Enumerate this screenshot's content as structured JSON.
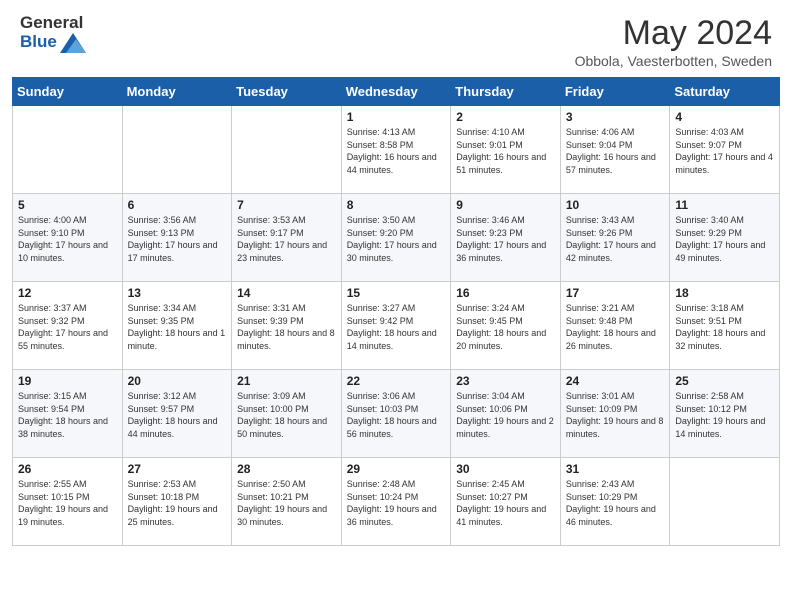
{
  "header": {
    "logo_general": "General",
    "logo_blue": "Blue",
    "title": "May 2024",
    "location": "Obbola, Vaesterbotten, Sweden"
  },
  "days_of_week": [
    "Sunday",
    "Monday",
    "Tuesday",
    "Wednesday",
    "Thursday",
    "Friday",
    "Saturday"
  ],
  "weeks": [
    [
      {
        "day": "",
        "sunrise": "",
        "sunset": "",
        "daylight": ""
      },
      {
        "day": "",
        "sunrise": "",
        "sunset": "",
        "daylight": ""
      },
      {
        "day": "",
        "sunrise": "",
        "sunset": "",
        "daylight": ""
      },
      {
        "day": "1",
        "sunrise": "Sunrise: 4:13 AM",
        "sunset": "Sunset: 8:58 PM",
        "daylight": "Daylight: 16 hours and 44 minutes."
      },
      {
        "day": "2",
        "sunrise": "Sunrise: 4:10 AM",
        "sunset": "Sunset: 9:01 PM",
        "daylight": "Daylight: 16 hours and 51 minutes."
      },
      {
        "day": "3",
        "sunrise": "Sunrise: 4:06 AM",
        "sunset": "Sunset: 9:04 PM",
        "daylight": "Daylight: 16 hours and 57 minutes."
      },
      {
        "day": "4",
        "sunrise": "Sunrise: 4:03 AM",
        "sunset": "Sunset: 9:07 PM",
        "daylight": "Daylight: 17 hours and 4 minutes."
      }
    ],
    [
      {
        "day": "5",
        "sunrise": "Sunrise: 4:00 AM",
        "sunset": "Sunset: 9:10 PM",
        "daylight": "Daylight: 17 hours and 10 minutes."
      },
      {
        "day": "6",
        "sunrise": "Sunrise: 3:56 AM",
        "sunset": "Sunset: 9:13 PM",
        "daylight": "Daylight: 17 hours and 17 minutes."
      },
      {
        "day": "7",
        "sunrise": "Sunrise: 3:53 AM",
        "sunset": "Sunset: 9:17 PM",
        "daylight": "Daylight: 17 hours and 23 minutes."
      },
      {
        "day": "8",
        "sunrise": "Sunrise: 3:50 AM",
        "sunset": "Sunset: 9:20 PM",
        "daylight": "Daylight: 17 hours and 30 minutes."
      },
      {
        "day": "9",
        "sunrise": "Sunrise: 3:46 AM",
        "sunset": "Sunset: 9:23 PM",
        "daylight": "Daylight: 17 hours and 36 minutes."
      },
      {
        "day": "10",
        "sunrise": "Sunrise: 3:43 AM",
        "sunset": "Sunset: 9:26 PM",
        "daylight": "Daylight: 17 hours and 42 minutes."
      },
      {
        "day": "11",
        "sunrise": "Sunrise: 3:40 AM",
        "sunset": "Sunset: 9:29 PM",
        "daylight": "Daylight: 17 hours and 49 minutes."
      }
    ],
    [
      {
        "day": "12",
        "sunrise": "Sunrise: 3:37 AM",
        "sunset": "Sunset: 9:32 PM",
        "daylight": "Daylight: 17 hours and 55 minutes."
      },
      {
        "day": "13",
        "sunrise": "Sunrise: 3:34 AM",
        "sunset": "Sunset: 9:35 PM",
        "daylight": "Daylight: 18 hours and 1 minute."
      },
      {
        "day": "14",
        "sunrise": "Sunrise: 3:31 AM",
        "sunset": "Sunset: 9:39 PM",
        "daylight": "Daylight: 18 hours and 8 minutes."
      },
      {
        "day": "15",
        "sunrise": "Sunrise: 3:27 AM",
        "sunset": "Sunset: 9:42 PM",
        "daylight": "Daylight: 18 hours and 14 minutes."
      },
      {
        "day": "16",
        "sunrise": "Sunrise: 3:24 AM",
        "sunset": "Sunset: 9:45 PM",
        "daylight": "Daylight: 18 hours and 20 minutes."
      },
      {
        "day": "17",
        "sunrise": "Sunrise: 3:21 AM",
        "sunset": "Sunset: 9:48 PM",
        "daylight": "Daylight: 18 hours and 26 minutes."
      },
      {
        "day": "18",
        "sunrise": "Sunrise: 3:18 AM",
        "sunset": "Sunset: 9:51 PM",
        "daylight": "Daylight: 18 hours and 32 minutes."
      }
    ],
    [
      {
        "day": "19",
        "sunrise": "Sunrise: 3:15 AM",
        "sunset": "Sunset: 9:54 PM",
        "daylight": "Daylight: 18 hours and 38 minutes."
      },
      {
        "day": "20",
        "sunrise": "Sunrise: 3:12 AM",
        "sunset": "Sunset: 9:57 PM",
        "daylight": "Daylight: 18 hours and 44 minutes."
      },
      {
        "day": "21",
        "sunrise": "Sunrise: 3:09 AM",
        "sunset": "Sunset: 10:00 PM",
        "daylight": "Daylight: 18 hours and 50 minutes."
      },
      {
        "day": "22",
        "sunrise": "Sunrise: 3:06 AM",
        "sunset": "Sunset: 10:03 PM",
        "daylight": "Daylight: 18 hours and 56 minutes."
      },
      {
        "day": "23",
        "sunrise": "Sunrise: 3:04 AM",
        "sunset": "Sunset: 10:06 PM",
        "daylight": "Daylight: 19 hours and 2 minutes."
      },
      {
        "day": "24",
        "sunrise": "Sunrise: 3:01 AM",
        "sunset": "Sunset: 10:09 PM",
        "daylight": "Daylight: 19 hours and 8 minutes."
      },
      {
        "day": "25",
        "sunrise": "Sunrise: 2:58 AM",
        "sunset": "Sunset: 10:12 PM",
        "daylight": "Daylight: 19 hours and 14 minutes."
      }
    ],
    [
      {
        "day": "26",
        "sunrise": "Sunrise: 2:55 AM",
        "sunset": "Sunset: 10:15 PM",
        "daylight": "Daylight: 19 hours and 19 minutes."
      },
      {
        "day": "27",
        "sunrise": "Sunrise: 2:53 AM",
        "sunset": "Sunset: 10:18 PM",
        "daylight": "Daylight: 19 hours and 25 minutes."
      },
      {
        "day": "28",
        "sunrise": "Sunrise: 2:50 AM",
        "sunset": "Sunset: 10:21 PM",
        "daylight": "Daylight: 19 hours and 30 minutes."
      },
      {
        "day": "29",
        "sunrise": "Sunrise: 2:48 AM",
        "sunset": "Sunset: 10:24 PM",
        "daylight": "Daylight: 19 hours and 36 minutes."
      },
      {
        "day": "30",
        "sunrise": "Sunrise: 2:45 AM",
        "sunset": "Sunset: 10:27 PM",
        "daylight": "Daylight: 19 hours and 41 minutes."
      },
      {
        "day": "31",
        "sunrise": "Sunrise: 2:43 AM",
        "sunset": "Sunset: 10:29 PM",
        "daylight": "Daylight: 19 hours and 46 minutes."
      },
      {
        "day": "",
        "sunrise": "",
        "sunset": "",
        "daylight": ""
      }
    ]
  ]
}
